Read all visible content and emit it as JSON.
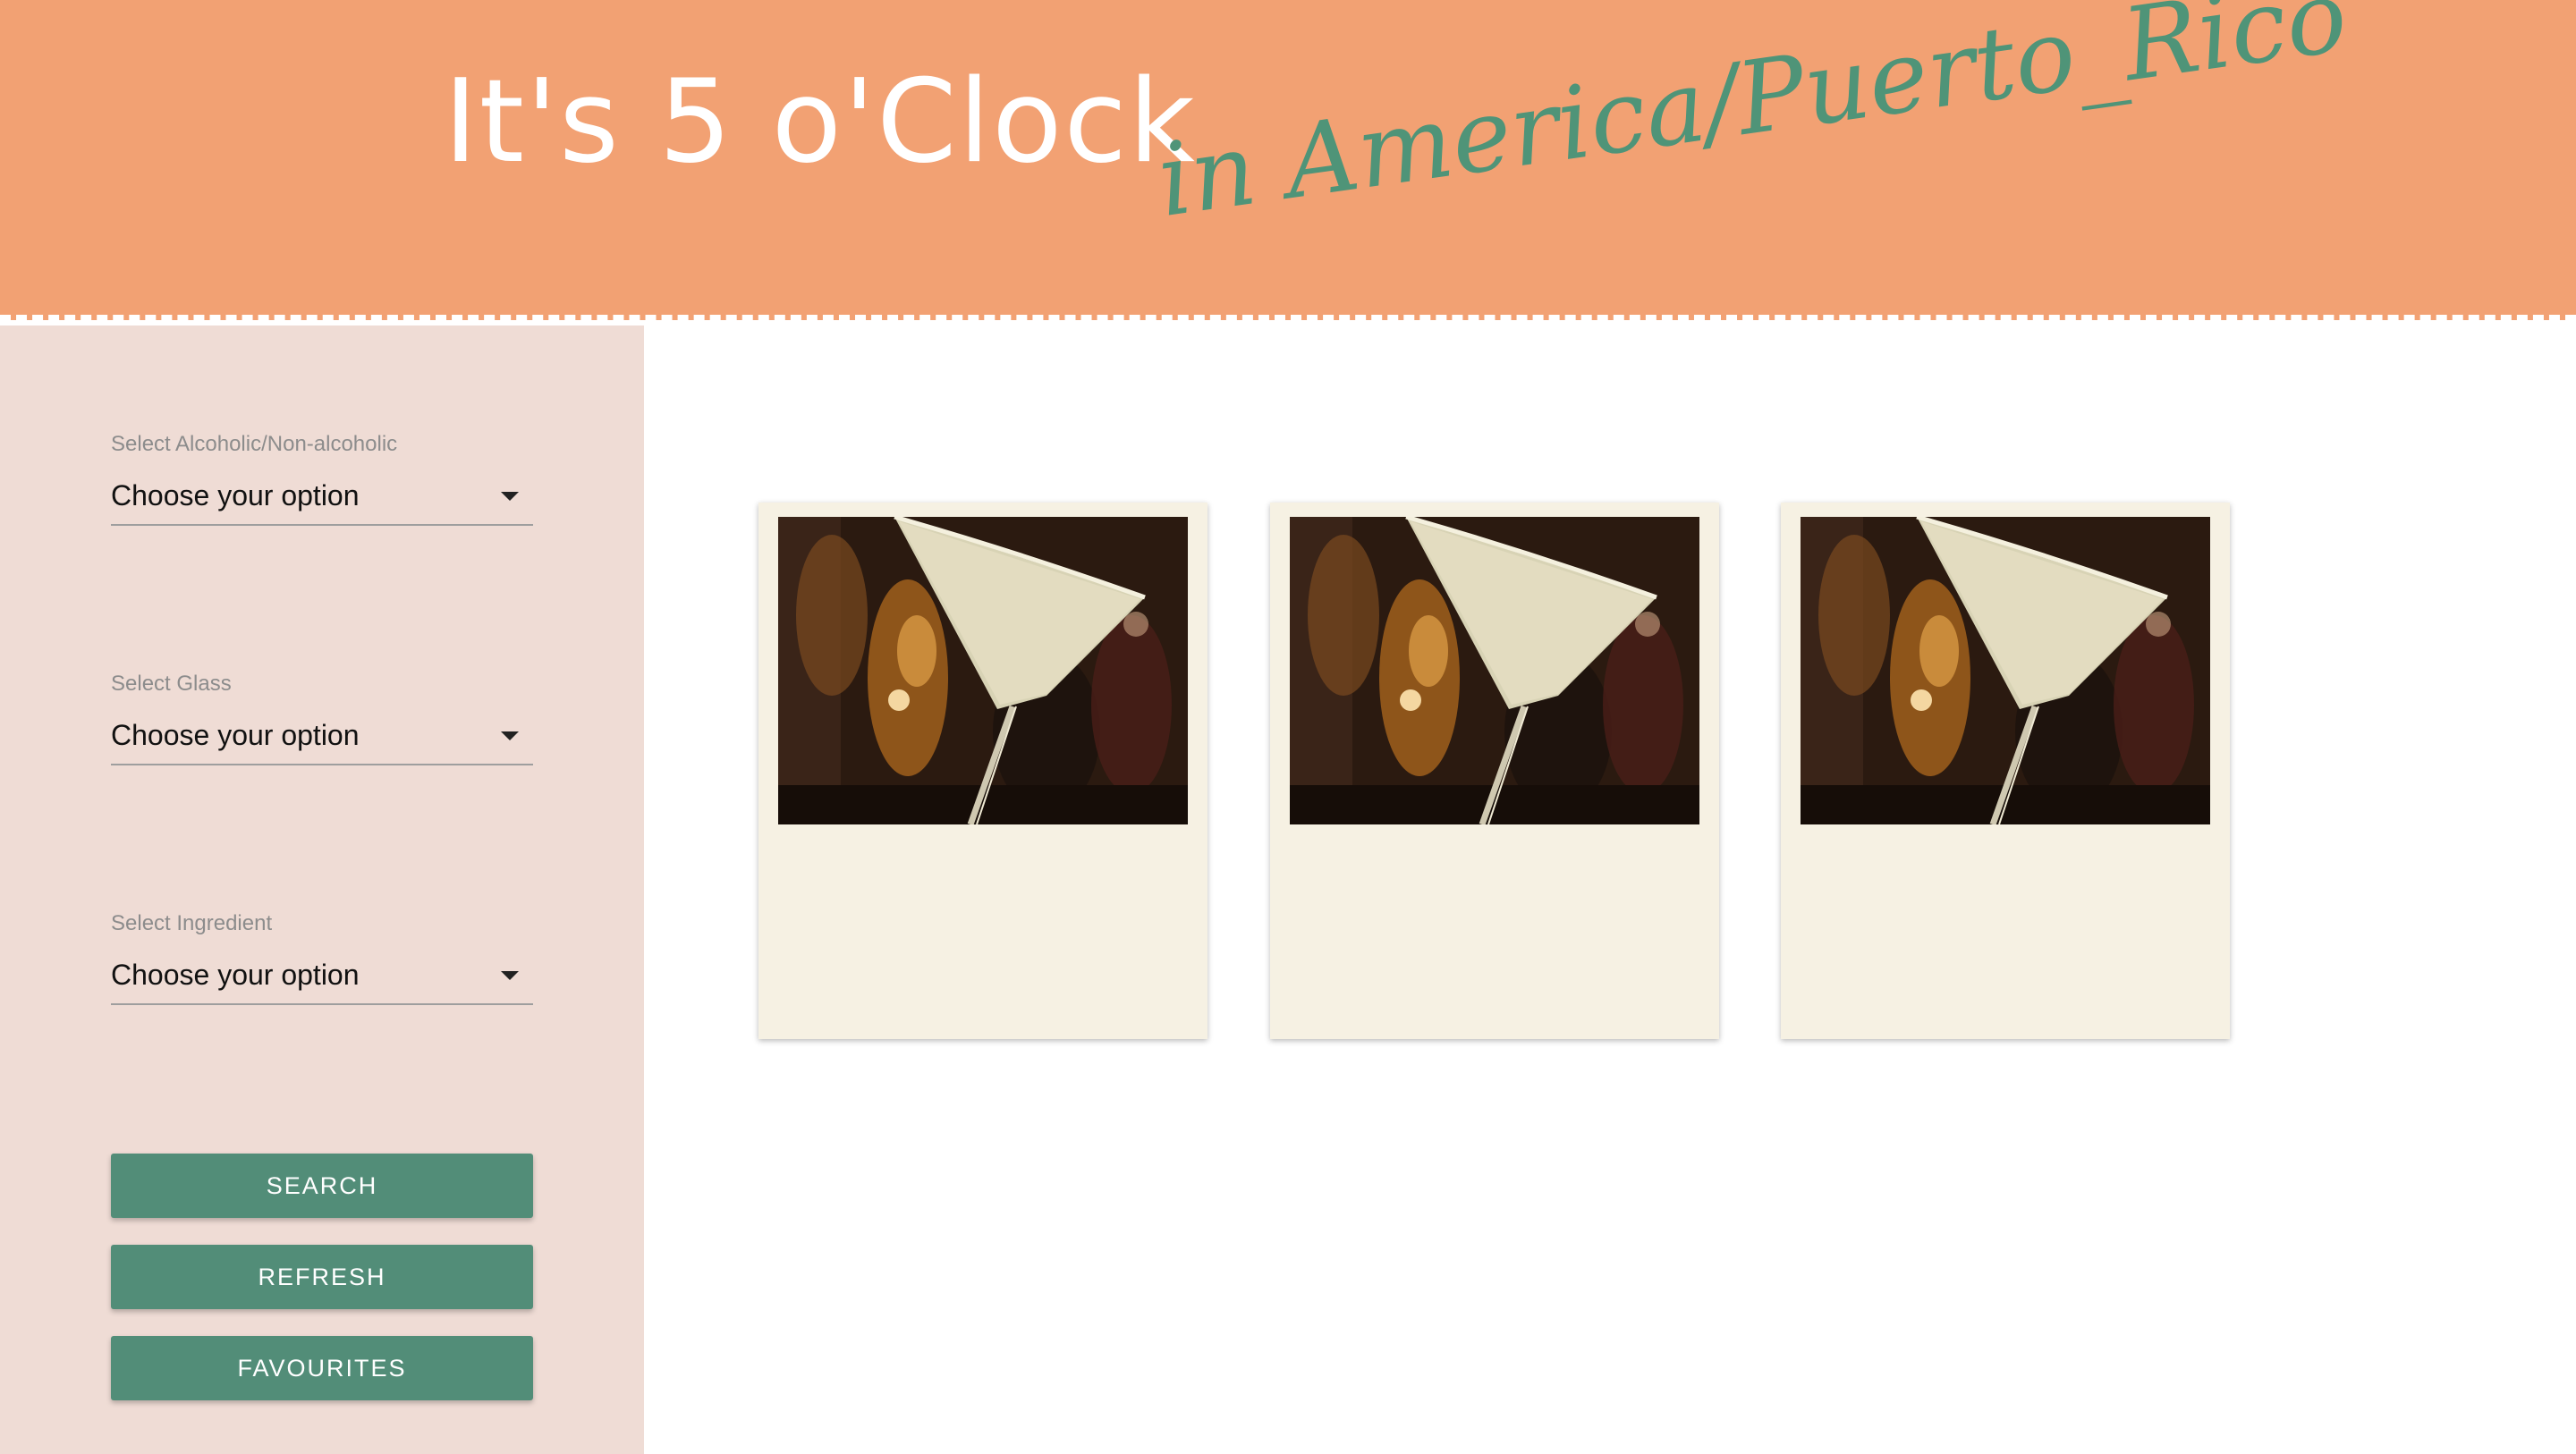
{
  "header": {
    "title": "It's 5 o'Clock",
    "location": "in America/Puerto_Rico"
  },
  "filters": [
    {
      "label": "Select Alcoholic/Non-alcoholic",
      "value": "Choose your option"
    },
    {
      "label": "Select Glass",
      "value": "Choose your option"
    },
    {
      "label": "Select Ingredient",
      "value": "Choose your option"
    }
  ],
  "buttons": {
    "search": "SEARCH",
    "refresh": "REFRESH",
    "favourites": "FAVOURITES"
  },
  "cards": [
    {
      "image": "martini-glass-photo"
    },
    {
      "image": "martini-glass-photo"
    },
    {
      "image": "martini-glass-photo"
    }
  ],
  "colors": {
    "header_bg": "#f2a173",
    "accent_green": "#528d78",
    "sidebar_bg": "#efdcd5",
    "card_bg": "#f6f1e3"
  }
}
